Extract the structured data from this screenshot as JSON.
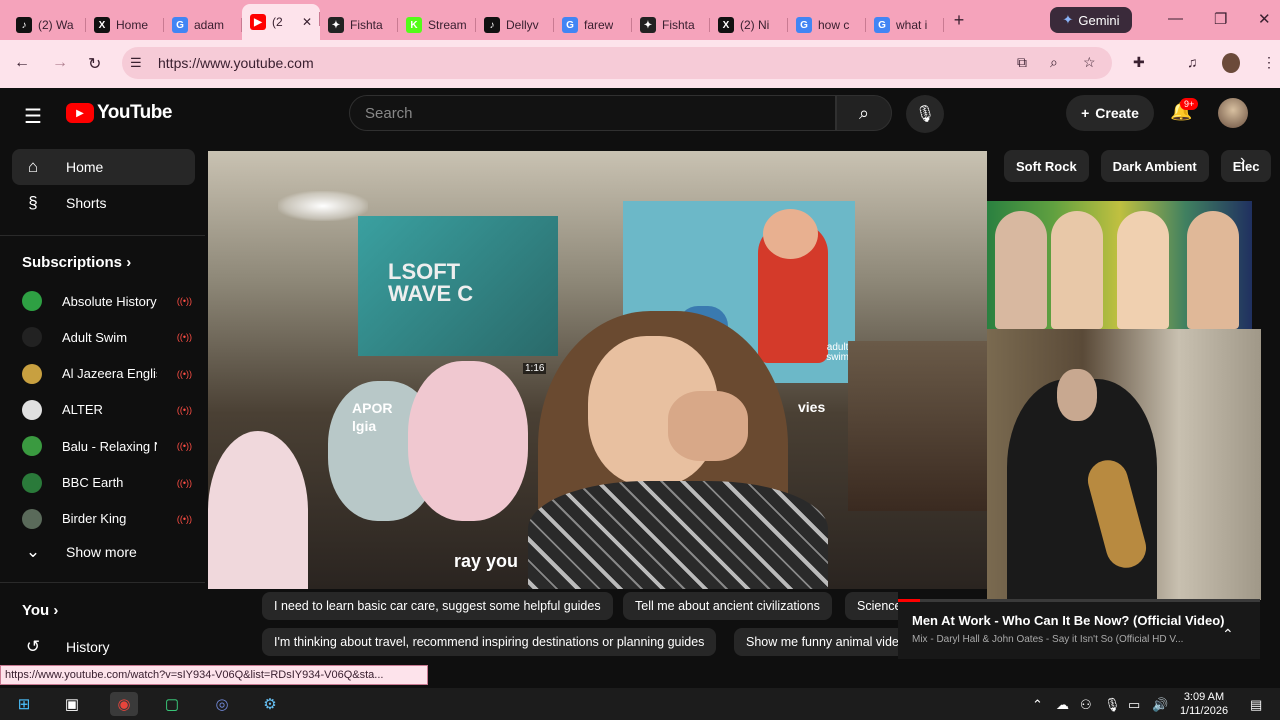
{
  "browser": {
    "tabs": [
      {
        "label": "(2) Wa",
        "fav": "tiktok-icon",
        "color": "#111111",
        "glyph": "♪"
      },
      {
        "label": "Home",
        "fav": "x-icon",
        "color": "#111111",
        "glyph": "X"
      },
      {
        "label": "adam",
        "fav": "google-icon",
        "color": "#4285f4",
        "glyph": "G"
      },
      {
        "label": "(2",
        "fav": "youtube-icon",
        "color": "#ff0000",
        "glyph": "▶",
        "active": true
      },
      {
        "label": "Fishta",
        "fav": "fishtank-icon",
        "color": "#222222",
        "glyph": "✦"
      },
      {
        "label": "Stream",
        "fav": "kick-icon",
        "color": "#53fc18",
        "glyph": "K"
      },
      {
        "label": "Dellyv",
        "fav": "tiktok-icon",
        "color": "#111111",
        "glyph": "♪"
      },
      {
        "label": "farew",
        "fav": "google-icon",
        "color": "#4285f4",
        "glyph": "G"
      },
      {
        "label": "Fishta",
        "fav": "fishtank-icon",
        "color": "#222222",
        "glyph": "✦"
      },
      {
        "label": "(2) Ni",
        "fav": "x-icon",
        "color": "#111111",
        "glyph": "X"
      },
      {
        "label": "how c",
        "fav": "google-icon",
        "color": "#4285f4",
        "glyph": "G"
      },
      {
        "label": "what i",
        "fav": "google-icon",
        "color": "#4285f4",
        "glyph": "G"
      }
    ],
    "new_tab": "+",
    "gemini_label": "Gemini",
    "url": "https://www.youtube.com",
    "status_url": "https://www.youtube.com/watch?v=sIY934-V06Q&list=RDsIY934-V06Q&sta..."
  },
  "youtube": {
    "logo_text": "YouTube",
    "search_placeholder": "Search",
    "create_label": "Create",
    "notif_badge": "9+",
    "nav": [
      {
        "label": "Home",
        "icon": "home-icon",
        "glyph": "⌂"
      },
      {
        "label": "Shorts",
        "icon": "shorts-icon",
        "glyph": "§"
      }
    ],
    "subscriptions_title": "Subscriptions",
    "subscriptions": [
      {
        "name": "Absolute History",
        "color": "#2ea043"
      },
      {
        "name": "Adult Swim",
        "color": "#222222"
      },
      {
        "name": "Al Jazeera English",
        "color": "#c8a040"
      },
      {
        "name": "ALTER",
        "color": "#e0e0e0"
      },
      {
        "name": "Balu - Relaxing N...",
        "color": "#3a9a40"
      },
      {
        "name": "BBC Earth",
        "color": "#2a7a3a"
      },
      {
        "name": "Birder King",
        "color": "#5a6a5a"
      }
    ],
    "live_glyph": "((•))",
    "show_more": "Show more",
    "you_title": "You",
    "history_label": "History",
    "chips": [
      "Soft Rock",
      "Dark Ambient",
      "Elec"
    ],
    "suggestions_row1": [
      "I need to learn basic car care, suggest some helpful guides",
      "Tell me about ancient civilizations",
      "Science"
    ],
    "suggestions_row2": [
      "I'm thinking about travel, recommend inspiring destinations or planning guides",
      "Show me funny animal vide"
    ]
  },
  "video_overlay": {
    "poster_text": "LSOFT\nWAVE C",
    "card_text_left": "APOR\nlgia",
    "card_text_right": "vies",
    "caption_fragment": "ray you",
    "duration_fragment": "1:16",
    "cartoon_tag": "adult\nswim"
  },
  "miniplayer": {
    "title": "Men At Work - Who Can It Be Now? (Official Video)",
    "subtitle": "Mix - Daryl Hall & John Oates - Say it Isn't So (Official HD V...",
    "progress": 0.06
  },
  "taskbar": {
    "time": "3:09 AM",
    "date": "1/11/2026"
  }
}
